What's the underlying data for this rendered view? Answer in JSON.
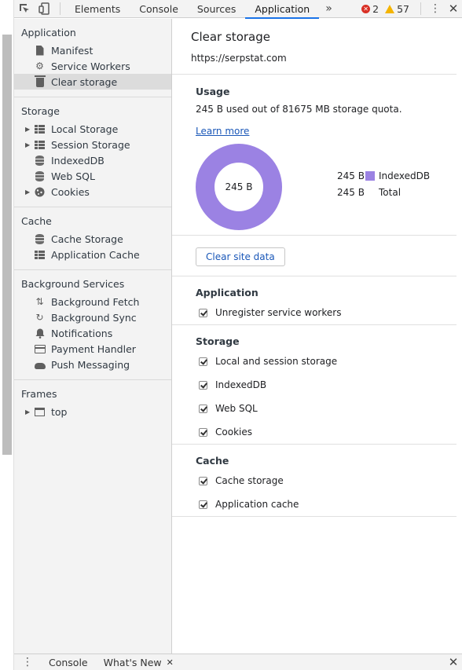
{
  "toolbar": {
    "tabs": [
      "Elements",
      "Console",
      "Sources",
      "Application"
    ],
    "active_tab": "Application",
    "more_label": "»",
    "errors": "2",
    "warnings": "57",
    "close_label": "✕"
  },
  "sidebar": {
    "application": {
      "title": "Application",
      "items": [
        "Manifest",
        "Service Workers",
        "Clear storage"
      ]
    },
    "storage": {
      "title": "Storage",
      "items": [
        "Local Storage",
        "Session Storage",
        "IndexedDB",
        "Web SQL",
        "Cookies"
      ]
    },
    "cache": {
      "title": "Cache",
      "items": [
        "Cache Storage",
        "Application Cache"
      ]
    },
    "background": {
      "title": "Background Services",
      "items": [
        "Background Fetch",
        "Background Sync",
        "Notifications",
        "Payment Handler",
        "Push Messaging"
      ]
    },
    "frames": {
      "title": "Frames",
      "items": [
        "top"
      ]
    }
  },
  "main": {
    "title": "Clear storage",
    "origin": "https://serpstat.com",
    "usage": {
      "title": "Usage",
      "summary": "245 B used out of 81675 MB storage quota.",
      "learn_more": "Learn more",
      "donut_label": "245 B",
      "legend": [
        {
          "value": "245 B",
          "label": "IndexedDB",
          "color": "#9b82e3"
        },
        {
          "value": "245 B",
          "label": "Total"
        }
      ],
      "donut_fraction": 1.0
    },
    "clear_button": "Clear site data",
    "application": {
      "title": "Application",
      "options": [
        "Unregister service workers"
      ]
    },
    "storage": {
      "title": "Storage",
      "options": [
        "Local and session storage",
        "IndexedDB",
        "Web SQL",
        "Cookies"
      ]
    },
    "cache": {
      "title": "Cache",
      "options": [
        "Cache storage",
        "Application cache"
      ]
    }
  },
  "drawer": {
    "tabs": [
      "Console",
      "What's New"
    ],
    "tab_close": "✕",
    "close_label": "✕"
  },
  "colors": {
    "accent": "#1a73e8",
    "donut": "#9b82e3",
    "link": "#1a57b8"
  }
}
